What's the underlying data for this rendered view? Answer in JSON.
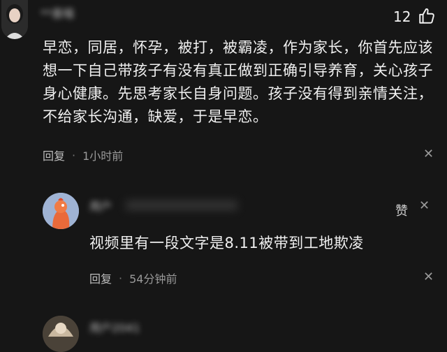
{
  "comment": {
    "username": "**喜喵",
    "likes": "12",
    "text": "早恋，同居，怀孕，被打，被霸凌，作为家长，你首先应该想一下自己带孩子有没有真正做到正确引导养育，关心孩子身心健康。先思考家长自身问题。孩子没有得到亲情关注，不给家长沟通，缺爱，于是早恋。",
    "reply_label": "回复",
    "time": "1小时前"
  },
  "reply1": {
    "username": "用户",
    "partial_label": "赞",
    "text": "视频里有一段文字是8.11被带到工地欺凌",
    "reply_label": "回复",
    "time": "54分钟前"
  },
  "reply2": {
    "username": "用户2041"
  },
  "icons": {
    "like": "thumbs-up-icon",
    "close": "close-icon"
  },
  "colors": {
    "background": "#161616",
    "text": "#f0f0f0",
    "muted": "#9a9a9a"
  }
}
